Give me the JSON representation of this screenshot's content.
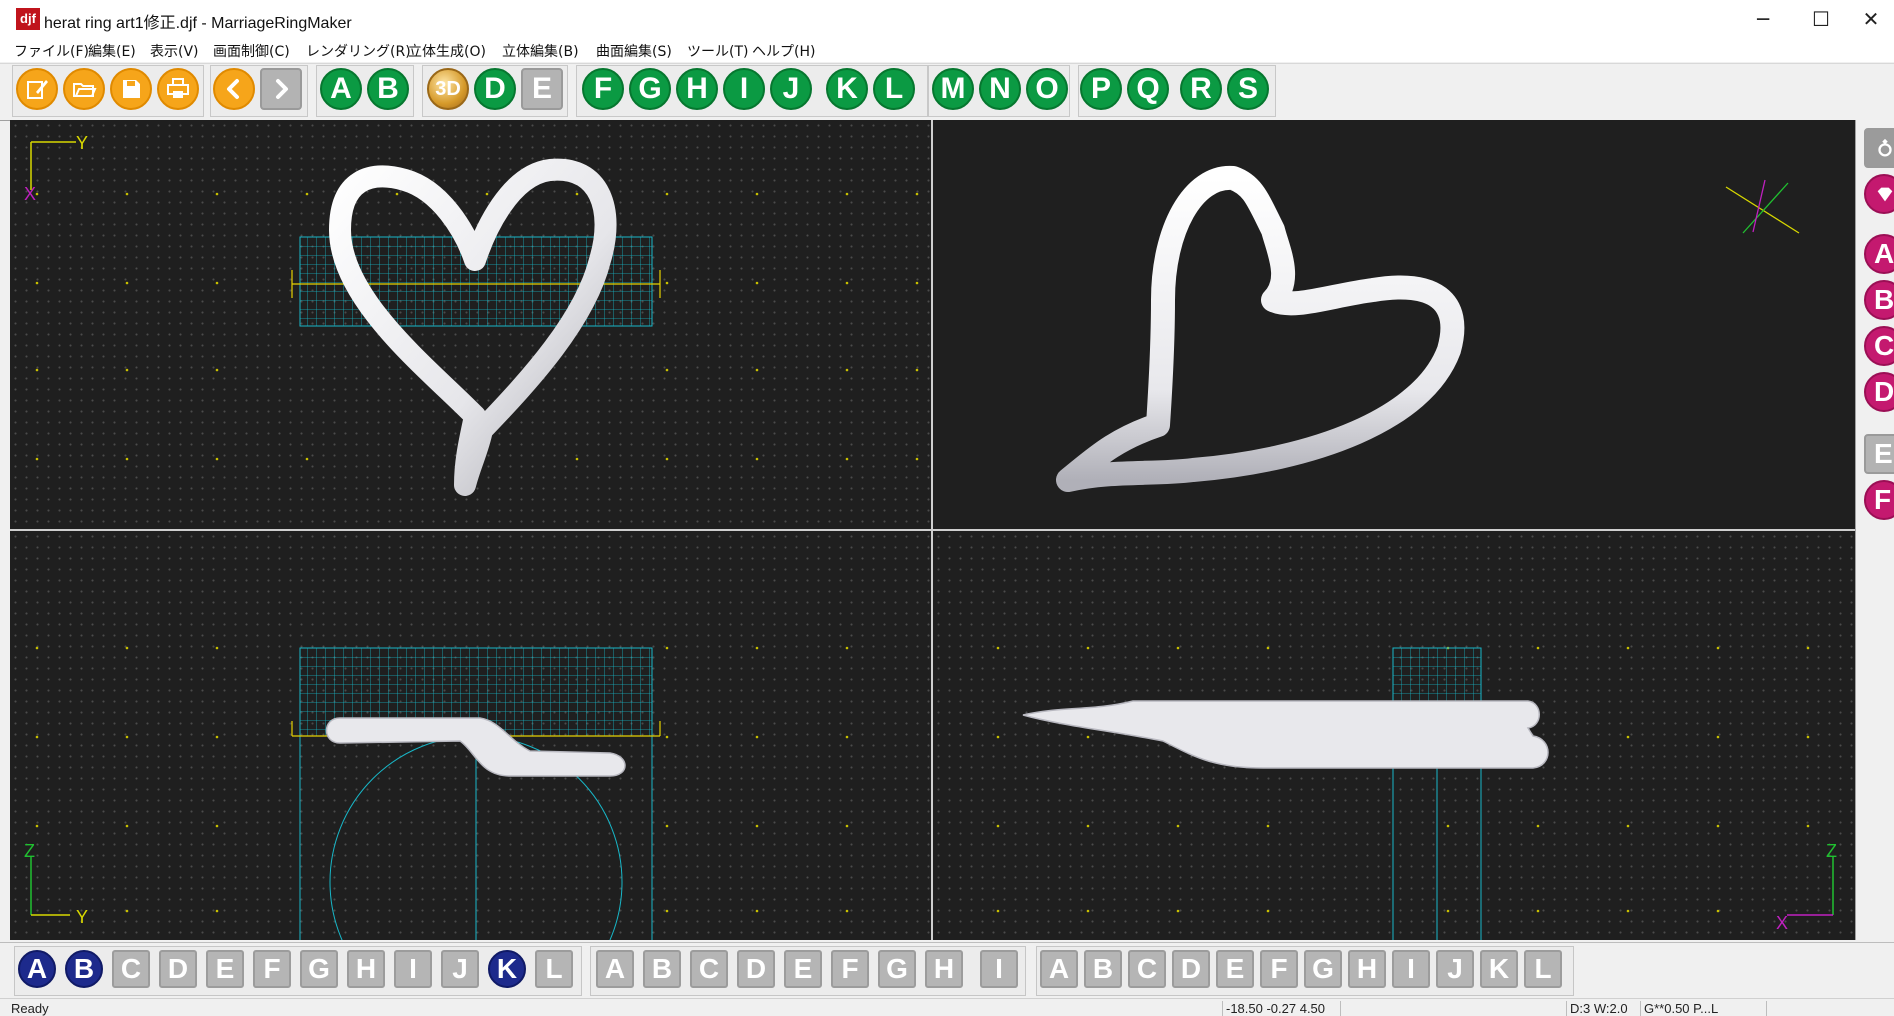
{
  "window": {
    "app_icon_text": "djf",
    "title": "herat ring art1修正.djf - MarriageRingMaker",
    "controls": [
      "─",
      "☐",
      "✕"
    ]
  },
  "menubar": [
    "ファイル(F)",
    "編集(E)",
    "表示(V)",
    "画面制御(C)",
    "レンダリング(R)",
    "立体生成(O)",
    "立体編集(B)",
    "曲面編集(S)",
    "ツール(T)",
    "ヘルプ(H)"
  ],
  "toolbar": {
    "file_icons": [
      "edit-icon",
      "open-folder-icon",
      "save-icon",
      "print-icon"
    ],
    "nav_icons": [
      "back-icon",
      "forward-icon"
    ],
    "group_ab": [
      "A",
      "B"
    ],
    "group_3d": [
      "3D",
      "D",
      "E"
    ],
    "group_f_l": [
      "F",
      "G",
      "H",
      "I",
      "J",
      "K",
      "L"
    ],
    "group_m_o": [
      "M",
      "N",
      "O"
    ],
    "group_p_s": [
      "P",
      "Q",
      "R",
      "S"
    ]
  },
  "viewports": {
    "top": {
      "axis_h": "Y",
      "axis_v": "X"
    },
    "front": {
      "axis_v": "Z",
      "axis_h": "Y"
    },
    "side": {
      "axis_v": "Z",
      "axis_h": "X"
    },
    "colors": {
      "grid": "#18b7c8",
      "dim": "#e6d200",
      "axis_y": "#d8d800",
      "axis_x": "#c020c0",
      "axis_z": "#20c030",
      "bg": "#1f1f1f"
    }
  },
  "right_panel": {
    "icons": [
      "ring-icon",
      "gem-icon"
    ],
    "buttons": [
      "A",
      "B",
      "C",
      "D",
      "E",
      "F"
    ]
  },
  "bottom_bar": {
    "group1": [
      "A",
      "B",
      "C",
      "D",
      "E",
      "F",
      "G",
      "H",
      "I",
      "J",
      "K",
      "L"
    ],
    "group2": [
      "A",
      "B",
      "C",
      "D",
      "E",
      "F",
      "G",
      "H",
      "I"
    ],
    "group3": [
      "A",
      "B",
      "C",
      "D",
      "E",
      "F",
      "G",
      "H",
      "I",
      "J",
      "K",
      "L"
    ]
  },
  "status": {
    "message": "Ready",
    "coords": "-18.50 -0.27 4.50",
    "dims": "D:3 W:2.0",
    "grid": "G**0.50 P...L"
  }
}
